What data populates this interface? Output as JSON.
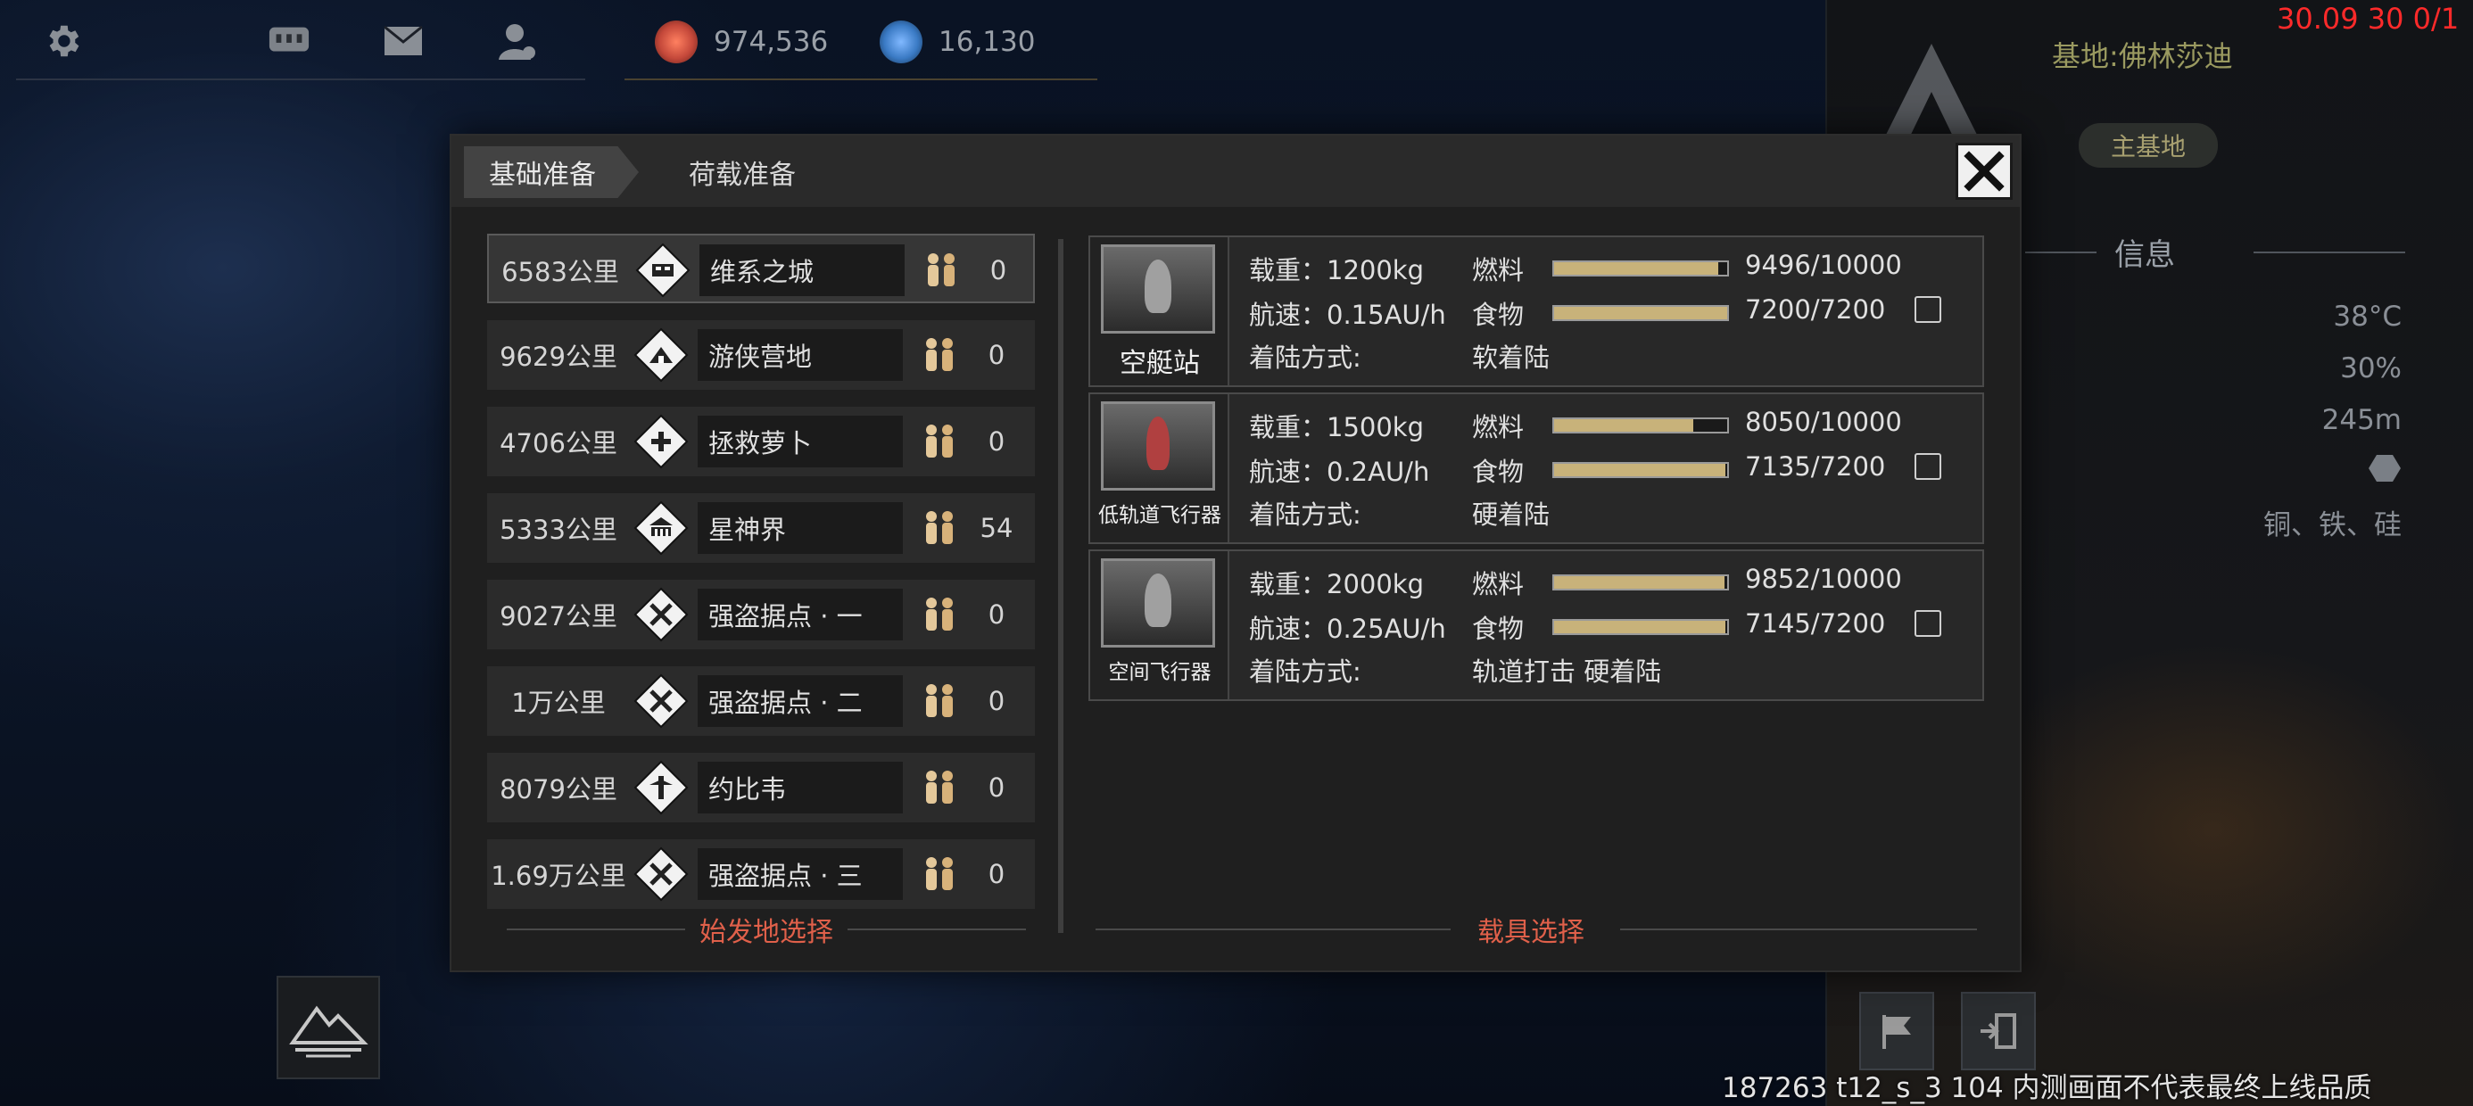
{
  "topbar": {
    "icons": [
      "gear-icon",
      "chat-icon",
      "mail-icon",
      "profile-icon"
    ],
    "resources": [
      {
        "name": "resource-red",
        "value": "974,536",
        "color": "#c4483a"
      },
      {
        "name": "resource-blue",
        "value": "16,130",
        "color": "#3a7ac4"
      }
    ]
  },
  "debug": {
    "top_right": "30.09 30 0/1",
    "footer": "187263 t12_s_3 104 内测画面不代表最终上线品质"
  },
  "base_panel": {
    "base_name": "基地:佛林莎迪",
    "tag": "主基地",
    "info_title": "信息",
    "rows": [
      "38°C",
      "30%",
      "245m",
      "",
      "铜、铁、硅"
    ]
  },
  "modal": {
    "tabs": [
      "基础准备",
      "荷载准备"
    ],
    "close_icon": "close-icon",
    "locations": [
      {
        "distance": "6583公里",
        "name": "维系之城",
        "count": "0",
        "icon": "city-icon",
        "selected": true
      },
      {
        "distance": "9629公里",
        "name": "游侠营地",
        "count": "0",
        "icon": "camp-icon",
        "selected": false
      },
      {
        "distance": "4706公里",
        "name": "拯救萝卜",
        "count": "0",
        "icon": "rescue-icon",
        "selected": false
      },
      {
        "distance": "5333公里",
        "name": "星神界",
        "count": "54",
        "icon": "temple-icon",
        "selected": false
      },
      {
        "distance": "9027公里",
        "name": "强盗据点 · 一",
        "count": "0",
        "icon": "bandit-icon",
        "selected": false
      },
      {
        "distance": "1万公里",
        "name": "强盗据点 · 二",
        "count": "0",
        "icon": "bandit-icon",
        "selected": false
      },
      {
        "distance": "8079公里",
        "name": "约比韦",
        "count": "0",
        "icon": "outpost-icon",
        "selected": false
      },
      {
        "distance": "1.69万公里",
        "name": "强盗据点 · 三",
        "count": "0",
        "icon": "bandit-icon",
        "selected": false
      }
    ],
    "origin_title": "始发地选择",
    "vehicle_title": "载具选择",
    "vehicles": [
      {
        "name": "空艇站",
        "load": "载重：1200kg",
        "speed": "航速：0.15AU/h",
        "landing_label": "着陆方式:",
        "landing": "软着陆",
        "fuel_label": "燃料",
        "fuel": "9496/10000",
        "fuel_ratio": 0.9496,
        "food_label": "食物",
        "food": "7200/7200",
        "food_ratio": 1.0,
        "checked": false
      },
      {
        "name": "低轨道飞行器",
        "load": "载重：1500kg",
        "speed": "航速：0.2AU/h",
        "landing_label": "着陆方式:",
        "landing": "硬着陆",
        "fuel_label": "燃料",
        "fuel": "8050/10000",
        "fuel_ratio": 0.805,
        "food_label": "食物",
        "food": "7135/7200",
        "food_ratio": 0.991,
        "checked": false
      },
      {
        "name": "空间飞行器",
        "load": "载重：2000kg",
        "speed": "航速：0.25AU/h",
        "landing_label": "着陆方式:",
        "landing": "轨道打击 硬着陆",
        "fuel_label": "燃料",
        "fuel": "9852/10000",
        "fuel_ratio": 0.9852,
        "food_label": "食物",
        "food": "7145/7200",
        "food_ratio": 0.992,
        "checked": false
      }
    ]
  }
}
